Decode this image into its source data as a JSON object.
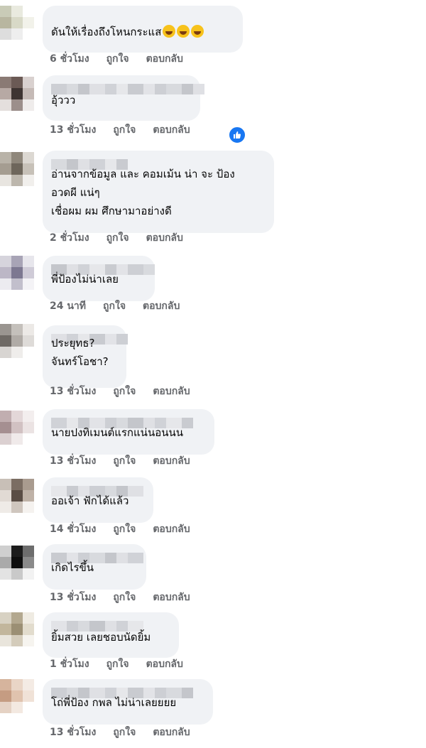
{
  "comments": [
    {
      "text_lines": [
        "ดันให้เรื่องถึงโหนกระแส"
      ],
      "emoji_count": 3,
      "time": "6 ชั่วโมง",
      "like_label": "ถูกใจ",
      "reply_label": "ตอบกลับ",
      "reaction": false
    },
    {
      "text_lines": [
        "อุ้ววว"
      ],
      "emoji_count": 0,
      "time": "13 ชั่วโมง",
      "like_label": "ถูกใจ",
      "reply_label": "ตอบกลับ",
      "reaction": true
    },
    {
      "text_lines": [
        "อ่านจากข้อมูล และ คอมเม้น น่า จะ ป้อง",
        "อวดผี แน่ๆ",
        "เชื่อผม ผม ศึกษามาอย่างดี"
      ],
      "emoji_count": 0,
      "time": "2 ชั่วโมง",
      "like_label": "ถูกใจ",
      "reply_label": "ตอบกลับ",
      "reaction": false
    },
    {
      "text_lines": [
        "พี่ป้องไม่น่าเลย"
      ],
      "emoji_count": 0,
      "time": "24 นาที",
      "like_label": "ถูกใจ",
      "reply_label": "ตอบกลับ",
      "reaction": false
    },
    {
      "text_lines": [
        "ประยุทธ?",
        "จันทร์โอชา?"
      ],
      "emoji_count": 0,
      "time": "13 ชั่วโมง",
      "like_label": "ถูกใจ",
      "reply_label": "ตอบกลับ",
      "reaction": false
    },
    {
      "text_lines": [
        "นายปงทิเมนต์แรกแน่นอนนน"
      ],
      "emoji_count": 0,
      "time": "13 ชั่วโมง",
      "like_label": "ถูกใจ",
      "reply_label": "ตอบกลับ",
      "reaction": false
    },
    {
      "text_lines": [
        "ออเจ้า ฟักได้แล้ว"
      ],
      "emoji_count": 0,
      "time": "14 ชั่วโมง",
      "like_label": "ถูกใจ",
      "reply_label": "ตอบกลับ",
      "reaction": false
    },
    {
      "text_lines": [
        "เกิดไรขึ้น"
      ],
      "emoji_count": 0,
      "time": "13 ชั่วโมง",
      "like_label": "ถูกใจ",
      "reply_label": "ตอบกลับ",
      "reaction": false
    },
    {
      "text_lines": [
        "ยิ้มสวย เลยชอบนัดยิ้ม"
      ],
      "emoji_count": 0,
      "time": "1 ชั่วโมง",
      "like_label": "ถูกใจ",
      "reply_label": "ตอบกลับ",
      "reaction": false
    },
    {
      "text_lines": [
        "โถ่พี่ป้อง กพล ไม่น่าเลยยยย"
      ],
      "emoji_count": 0,
      "time": "13 ชั่วโมง",
      "like_label": "ถูกใจ",
      "reply_label": "ตอบกลับ",
      "reaction": false
    }
  ],
  "colors": {
    "bubble": "#f0f2f5",
    "meta_text": "#65676b",
    "like_badge": "#1877f2"
  },
  "icons": {
    "emoji": "rolling-laughing-emoji-icon",
    "reaction": "thumbs-up-icon"
  }
}
